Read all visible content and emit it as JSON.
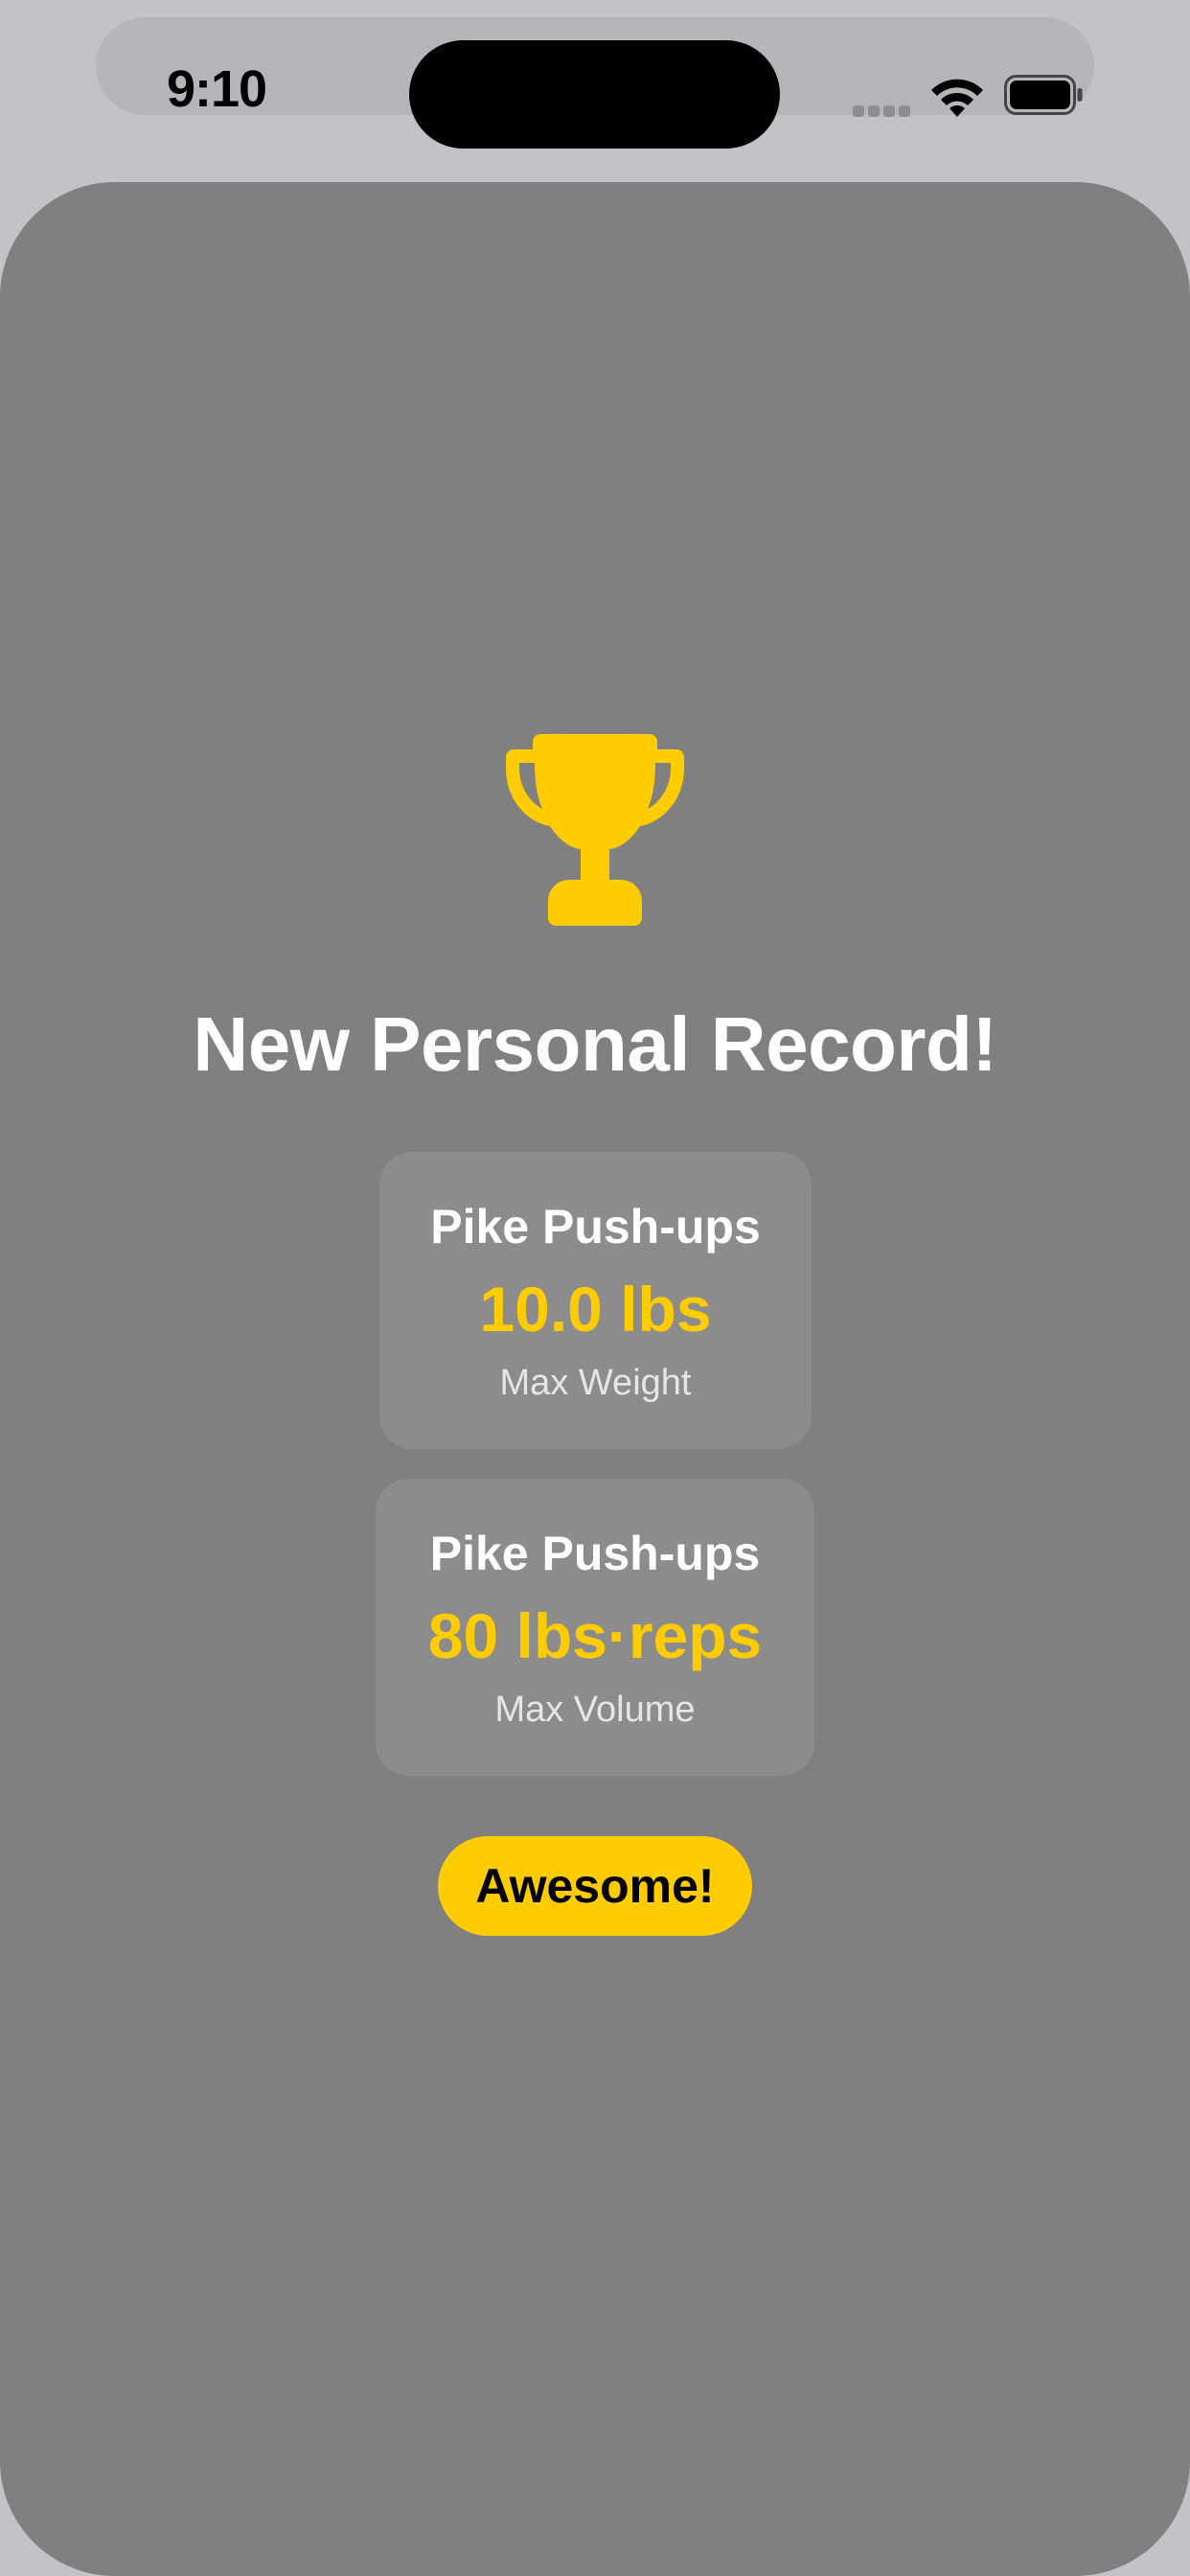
{
  "status_bar": {
    "time": "9:10"
  },
  "modal": {
    "icon": "trophy-icon",
    "title": "New Personal Record!",
    "records": [
      {
        "exercise": "Pike Push-ups",
        "value": "10.0 lbs",
        "label": "Max Weight"
      },
      {
        "exercise": "Pike Push-ups",
        "value": "80 lbs·reps",
        "label": "Max Volume"
      }
    ],
    "button_label": "Awesome!"
  },
  "colors": {
    "accent": "#ffcc00",
    "overlay": "#808080",
    "card": "#8c8c8c",
    "text": "#ffffff"
  }
}
